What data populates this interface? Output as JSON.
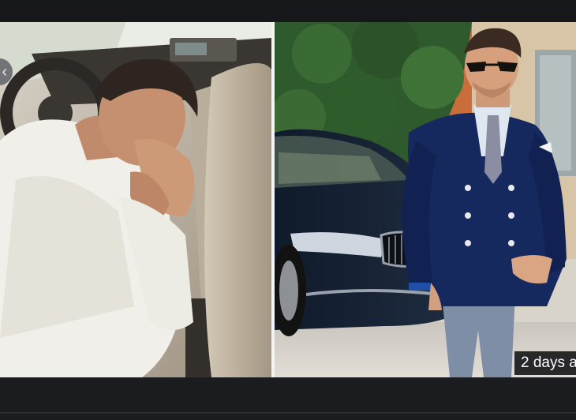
{
  "viewer": {
    "timestamp_text": "2 days a",
    "prev_icon_glyph": "‹",
    "icons": {
      "prev": "chevron-left-icon"
    }
  },
  "photos": {
    "left": "driver-crying-in-car-photo",
    "right": "man-in-suit-beside-car-photo"
  },
  "colors": {
    "background": "#17181c",
    "overlay": "#18191c",
    "text": "#ffffff"
  }
}
